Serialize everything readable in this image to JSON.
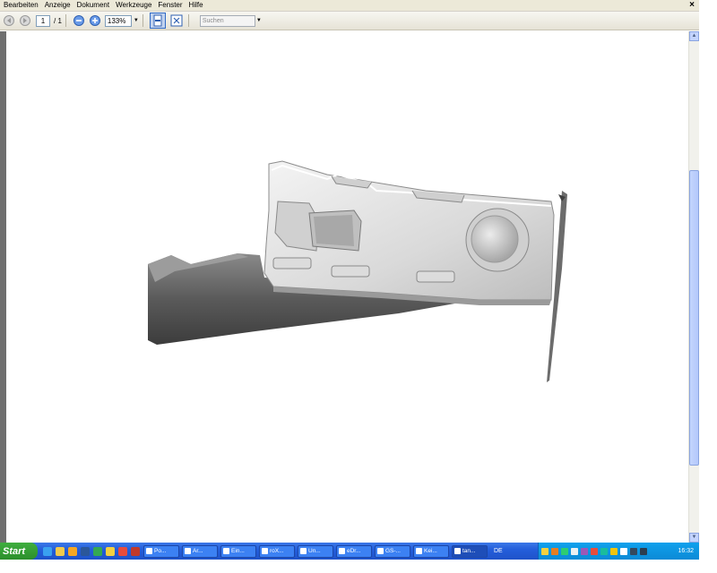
{
  "menubar": {
    "items": [
      "Bearbeiten",
      "Anzeige",
      "Dokument",
      "Werkzeuge",
      "Fenster",
      "Hilfe"
    ],
    "close_glyph": "×"
  },
  "toolbar": {
    "page_current": "1",
    "page_total": "/ 1",
    "zoom": "133%",
    "search_placeholder": "Suchen"
  },
  "document": {
    "content": "3D rendered part",
    "accent": "#6f6f6f"
  },
  "taskbar": {
    "start_label": "Start",
    "tasks": [
      {
        "label": "Po...",
        "icon": "app-icon"
      },
      {
        "label": "Ar...",
        "icon": "folder-icon"
      },
      {
        "label": "Ein...",
        "icon": "mail-icon"
      },
      {
        "label": "roX...",
        "icon": "doc-icon"
      },
      {
        "label": "Un...",
        "icon": "mail-icon"
      },
      {
        "label": "eDr...",
        "icon": "app-icon"
      },
      {
        "label": "GS-...",
        "icon": "doc-icon"
      },
      {
        "label": "Kei...",
        "icon": "mail-icon"
      },
      {
        "label": "tan...",
        "icon": "pdf-icon"
      }
    ],
    "language": "DE",
    "clock": "16:32"
  }
}
